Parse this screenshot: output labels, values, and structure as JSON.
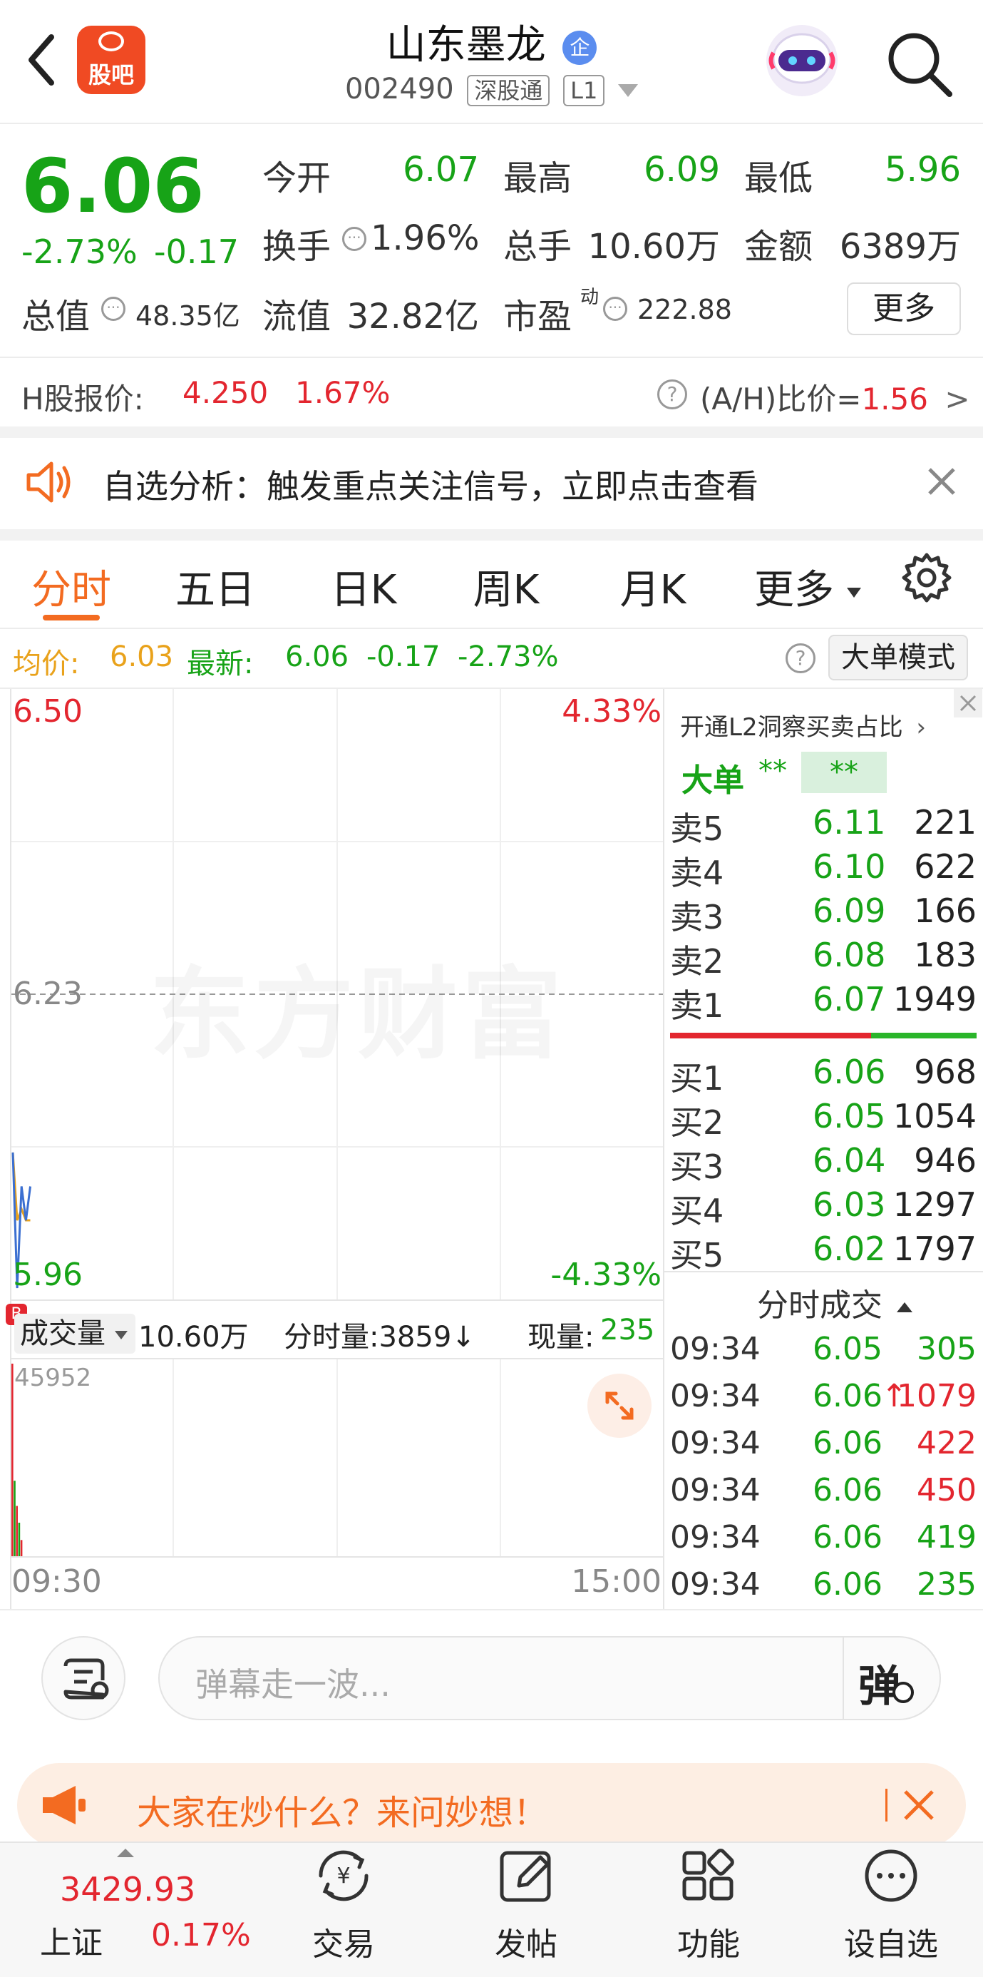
{
  "header": {
    "title": "山东墨龙",
    "badge": "企",
    "code": "002490",
    "tag1": "深股通",
    "tag2": "L1",
    "app_logo": "股吧"
  },
  "quote": {
    "price": "6.06",
    "change_pct": "-2.73%",
    "change": "-0.17",
    "open_label": "今开",
    "open": "6.07",
    "high_label": "最高",
    "high": "6.09",
    "low_label": "最低",
    "low": "5.96",
    "turnover_label": "换手",
    "turnover": "1.96%",
    "volume_label": "总手",
    "volume": "10.60万",
    "amount_label": "金额",
    "amount": "6389万",
    "mktcap_label": "总值",
    "mktcap": "48.35亿",
    "float_label": "流值",
    "float": "32.82亿",
    "pe_label": "市盈",
    "pe_sup": "动",
    "pe": "222.88",
    "more_label": "更多"
  },
  "hshare": {
    "label": "H股报价:",
    "price": "4.250",
    "pct": "1.67%",
    "ratio_label": "(A/H)比价=",
    "ratio": "1.56",
    "arrow": ">"
  },
  "alert": {
    "text": "自选分析：触发重点关注信号，立即点击查看"
  },
  "tabs": [
    "分时",
    "五日",
    "日K",
    "周K",
    "月K",
    "更多"
  ],
  "avg_bar": {
    "avg_label": "均价:",
    "avg": "6.03",
    "latest_label": "最新:",
    "latest": "6.06",
    "change": "-0.17",
    "pct": "-2.73%",
    "mode_button": "大单模式"
  },
  "chart": {
    "y_top": "6.50",
    "y_mid": "6.23",
    "y_bot": "5.96",
    "pct_top": "4.33%",
    "pct_bot": "-4.33%",
    "watermark": "东方财富",
    "vol_label": "成交量",
    "vol_total": "10.60万",
    "minute_vol": "分时量:3859↓",
    "current_vol_label": "现量:",
    "current_vol": "235",
    "vol_max": "45952",
    "time_start": "09:30",
    "time_end": "15:00"
  },
  "chart_data": {
    "type": "line",
    "x": [
      "09:30",
      "09:31",
      "09:32",
      "09:33",
      "09:34"
    ],
    "price": [
      6.09,
      5.97,
      6.06,
      6.03,
      6.06
    ],
    "avg": [
      6.09,
      6.03,
      6.04,
      6.03,
      6.03
    ],
    "volume": [
      45952,
      18000,
      12000,
      8000,
      3859
    ],
    "ylim": [
      5.96,
      6.5
    ]
  },
  "orderbook": {
    "l2_link": "开通L2洞察买卖占比",
    "big_label": "大单",
    "big_v1": "**",
    "big_v2": "**",
    "asks": [
      {
        "label": "卖5",
        "price": "6.11",
        "vol": "221"
      },
      {
        "label": "卖4",
        "price": "6.10",
        "vol": "622"
      },
      {
        "label": "卖3",
        "price": "6.09",
        "vol": "166"
      },
      {
        "label": "卖2",
        "price": "6.08",
        "vol": "183"
      },
      {
        "label": "卖1",
        "price": "6.07",
        "vol": "1949"
      }
    ],
    "bids": [
      {
        "label": "买1",
        "price": "6.06",
        "vol": "968"
      },
      {
        "label": "买2",
        "price": "6.05",
        "vol": "1054"
      },
      {
        "label": "买3",
        "price": "6.04",
        "vol": "946"
      },
      {
        "label": "买4",
        "price": "6.03",
        "vol": "1297"
      },
      {
        "label": "买5",
        "price": "6.02",
        "vol": "1797"
      }
    ],
    "trades_title": "分时成交",
    "trades": [
      {
        "time": "09:34",
        "price": "6.05",
        "vol": "305",
        "arrow": ""
      },
      {
        "time": "09:34",
        "price": "6.06",
        "vol": "1079",
        "arrow": "↑"
      },
      {
        "time": "09:34",
        "price": "6.06",
        "vol": "422",
        "arrow": ""
      },
      {
        "time": "09:34",
        "price": "6.06",
        "vol": "450",
        "arrow": ""
      },
      {
        "time": "09:34",
        "price": "6.06",
        "vol": "419",
        "arrow": ""
      },
      {
        "time": "09:34",
        "price": "6.06",
        "vol": "235",
        "arrow": ""
      }
    ]
  },
  "comment": {
    "placeholder": "弹幕走一波...",
    "danmu_btn": "弹"
  },
  "promo": {
    "text": "大家在炒什么？来问妙想！"
  },
  "bottom_nav": {
    "index_value": "3429.93",
    "index_name": "上证",
    "index_pct": "0.17%",
    "items": [
      "交易",
      "发帖",
      "功能",
      "设自选"
    ]
  },
  "colors": {
    "up": "#e3262f",
    "down": "#17a317",
    "accent": "#f36b21"
  }
}
